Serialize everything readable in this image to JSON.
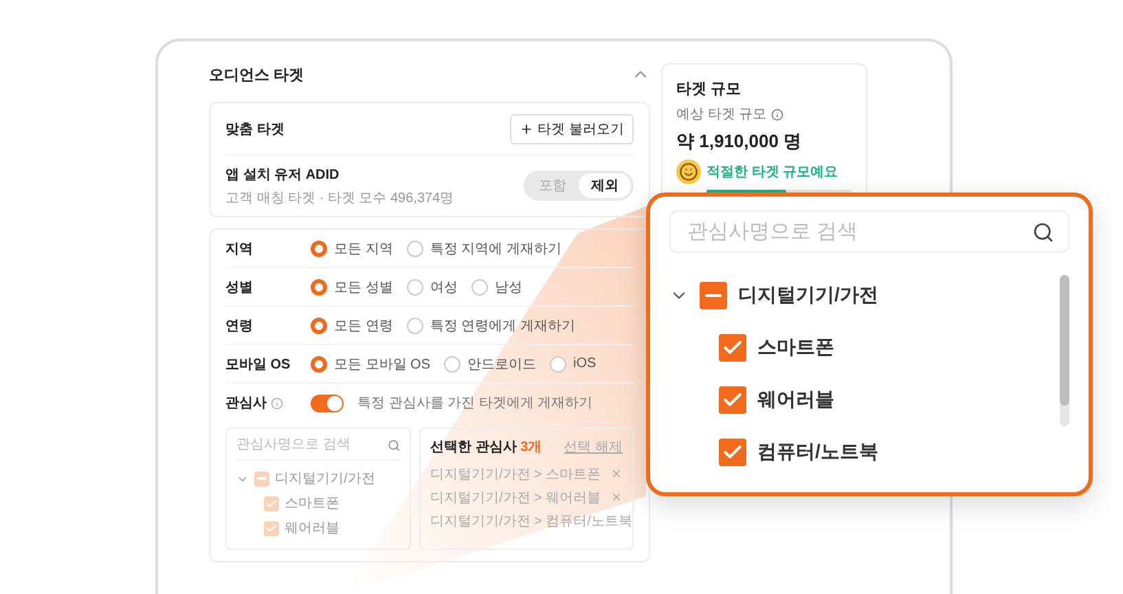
{
  "section": {
    "title": "오디언스 타겟",
    "expanded": true
  },
  "custom_target": {
    "title": "맞춤 타겟",
    "load_button": "타겟 불러오기",
    "item": {
      "name": "앱 설치 유저 ADID",
      "meta": "고객 매칭 타겟 · 타겟 모수 496,374명",
      "modes": [
        {
          "label": "포함",
          "selected": false
        },
        {
          "label": "제외",
          "selected": true
        }
      ]
    }
  },
  "options": [
    {
      "label": "지역",
      "choices": [
        {
          "label": "모든 지역",
          "selected": true
        },
        {
          "label": "특정 지역에 게재하기",
          "selected": false
        }
      ]
    },
    {
      "label": "성별",
      "choices": [
        {
          "label": "모든 성별",
          "selected": true
        },
        {
          "label": "여성",
          "selected": false
        },
        {
          "label": "남성",
          "selected": false
        }
      ]
    },
    {
      "label": "연령",
      "choices": [
        {
          "label": "모든 연령",
          "selected": true
        },
        {
          "label": "특정 연령에게 게재하기",
          "selected": false
        }
      ]
    },
    {
      "label": "모바일 OS",
      "choices": [
        {
          "label": "모든 모바일 OS",
          "selected": true
        },
        {
          "label": "안드로이드",
          "selected": false
        },
        {
          "label": "iOS",
          "selected": false
        }
      ]
    }
  ],
  "interest": {
    "label": "관심사",
    "on": true,
    "toggle_label": "특정 관심사를 가진 타겟에게 게재하기",
    "search": {
      "placeholder": "관심사명으로 검색"
    },
    "tree": [
      {
        "label": "디지털기기/가전",
        "expanded": true,
        "indeterminate": true,
        "children": [
          {
            "label": "스마트폰",
            "checked": true
          },
          {
            "label": "웨어러블",
            "checked": true
          }
        ]
      }
    ],
    "selected": {
      "title": "선택한 관심사",
      "count": "3개",
      "clear": "선택 해제",
      "items": [
        "디지털기기/가전 > 스마트폰",
        "디지털기기/가전 > 웨어러블",
        "디지털기기/가전 > 컴퓨터/노트북"
      ]
    }
  },
  "target_size": {
    "title": "타겟 규모",
    "label": "예상 타겟 규모",
    "value": "약 1,910,000 명",
    "verdict": "적절한 타겟 규모예요",
    "level": 0.55
  },
  "zoom_panel": {
    "search": {
      "placeholder": "관심사명으로 검색"
    },
    "tree": [
      {
        "label": "디지털기기/가전",
        "expanded": true,
        "indeterminate": true,
        "children": [
          {
            "label": "스마트폰",
            "checked": true
          },
          {
            "label": "웨어러블",
            "checked": true
          },
          {
            "label": "컴퓨터/노트북",
            "checked": true
          }
        ]
      }
    ]
  }
}
